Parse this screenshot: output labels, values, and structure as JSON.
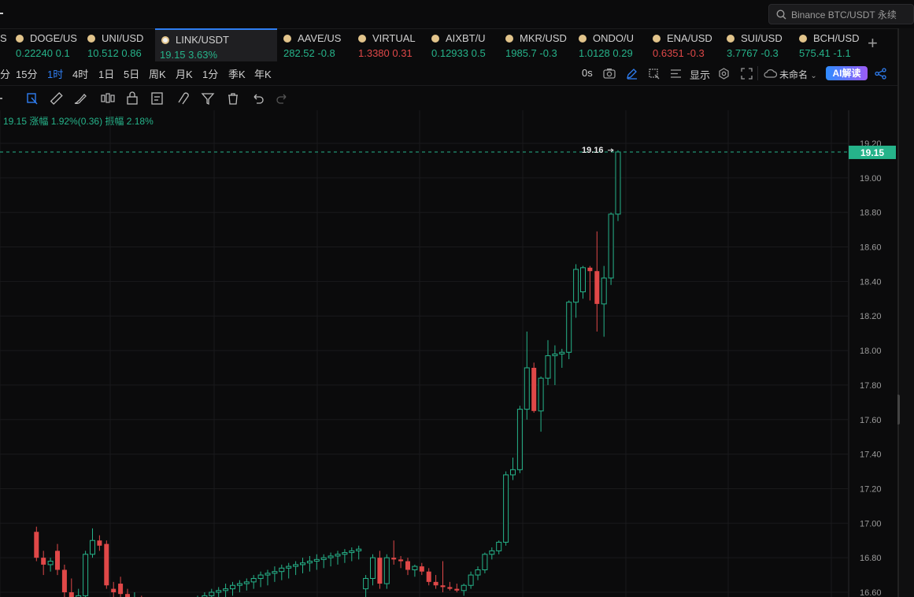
{
  "search": {
    "text": "Binance BTC/USDT 永续"
  },
  "tickers": [
    {
      "name": "S",
      "price": "",
      "change": "",
      "dir": "up",
      "icon": false
    },
    {
      "name": "DOGE/US",
      "price": "0.22240",
      "change": "0.1",
      "dir": "up",
      "icon": true
    },
    {
      "name": "UNI/USD",
      "price": "10.512",
      "change": "0.86",
      "dir": "up",
      "icon": true
    },
    {
      "name": "LINK/USDT",
      "price": "19.15",
      "change": "3.63%",
      "dir": "up",
      "icon": true,
      "active": true
    },
    {
      "name": "AAVE/US",
      "price": "282.52",
      "change": "-0.8",
      "dir": "up",
      "icon": true
    },
    {
      "name": "VIRTUAL",
      "price": "1.3380",
      "change": "0.31",
      "dir": "dn",
      "icon": true
    },
    {
      "name": "AIXBT/U",
      "price": "0.12933",
      "change": "0.5",
      "dir": "up",
      "icon": true
    },
    {
      "name": "MKR/USD",
      "price": "1985.7",
      "change": "-0.3",
      "dir": "up",
      "icon": true
    },
    {
      "name": "ONDO/U",
      "price": "1.0128",
      "change": "0.29",
      "dir": "up",
      "icon": true
    },
    {
      "name": "ENA/USD",
      "price": "0.6351",
      "change": "-0.3",
      "dir": "dn",
      "icon": true
    },
    {
      "name": "SUI/USD",
      "price": "3.7767",
      "change": "-0.3",
      "dir": "up",
      "icon": true
    },
    {
      "name": "BCH/USD",
      "price": "575.41",
      "change": "-1.1",
      "dir": "up",
      "icon": true
    }
  ],
  "intervals": [
    "分",
    "15分",
    "1时",
    "4时",
    "1日",
    "5日",
    "周K",
    "月K",
    "1分",
    "季K",
    "年K"
  ],
  "selected_interval": "1时",
  "toolbar": {
    "countdown": "0s",
    "display": "显示",
    "layout_name": "未命名",
    "ai_label": "AI解读"
  },
  "info": {
    "text": "19.15 涨幅 1.92%(0.36) 振幅 2.18%"
  },
  "colors": {
    "up": "#26b38a",
    "down": "#e04848",
    "accent": "#2f7ef2",
    "background": "#0b0b0c"
  },
  "chart_data": {
    "type": "candlestick",
    "symbol": "LINK/USDT",
    "interval": "1时",
    "ylim": [
      16.6,
      19.2
    ],
    "y_ticks": [
      "19.20",
      "19.00",
      "18.80",
      "18.60",
      "18.40",
      "18.20",
      "18.00",
      "17.80",
      "17.60",
      "17.40",
      "17.20",
      "17.00",
      "16.80",
      "16.60"
    ],
    "last_price": 19.15,
    "last_price_label": "19.15",
    "high_marker": {
      "value": 19.16,
      "label": "19.16"
    },
    "candles": [
      {
        "o": 16.95,
        "h": 16.98,
        "l": 16.78,
        "c": 16.8
      },
      {
        "o": 16.8,
        "h": 16.84,
        "l": 16.7,
        "c": 16.76
      },
      {
        "o": 16.76,
        "h": 16.8,
        "l": 16.72,
        "c": 16.78
      },
      {
        "o": 16.84,
        "h": 16.88,
        "l": 16.7,
        "c": 16.73
      },
      {
        "o": 16.73,
        "h": 16.76,
        "l": 16.55,
        "c": 16.6
      },
      {
        "o": 16.6,
        "h": 16.68,
        "l": 16.5,
        "c": 16.55
      },
      {
        "o": 16.55,
        "h": 16.62,
        "l": 16.48,
        "c": 16.58
      },
      {
        "o": 16.58,
        "h": 16.84,
        "l": 16.56,
        "c": 16.82
      },
      {
        "o": 16.82,
        "h": 16.97,
        "l": 16.8,
        "c": 16.9
      },
      {
        "o": 16.9,
        "h": 16.93,
        "l": 16.84,
        "c": 16.87
      },
      {
        "o": 16.88,
        "h": 16.9,
        "l": 16.62,
        "c": 16.64
      },
      {
        "o": 16.62,
        "h": 16.66,
        "l": 16.55,
        "c": 16.6
      },
      {
        "o": 16.65,
        "h": 16.69,
        "l": 16.56,
        "c": 16.59
      },
      {
        "o": 16.59,
        "h": 16.62,
        "l": 16.5,
        "c": 16.53
      },
      {
        "o": 16.55,
        "h": 16.6,
        "l": 16.52,
        "c": 16.56
      },
      {
        "o": 16.56,
        "h": 16.58,
        "l": 16.5,
        "c": 16.52
      },
      {
        "o": 16.53,
        "h": 16.56,
        "l": 16.49,
        "c": 16.51
      },
      {
        "o": 16.52,
        "h": 16.55,
        "l": 16.48,
        "c": 16.5
      },
      {
        "o": 16.51,
        "h": 16.53,
        "l": 16.46,
        "c": 16.49
      },
      {
        "o": 16.5,
        "h": 16.52,
        "l": 16.45,
        "c": 16.48
      },
      {
        "o": 16.49,
        "h": 16.52,
        "l": 16.44,
        "c": 16.5
      },
      {
        "o": 16.5,
        "h": 16.55,
        "l": 16.47,
        "c": 16.52
      },
      {
        "o": 16.52,
        "h": 16.56,
        "l": 16.48,
        "c": 16.54
      },
      {
        "o": 16.54,
        "h": 16.58,
        "l": 16.5,
        "c": 16.56
      },
      {
        "o": 16.56,
        "h": 16.6,
        "l": 16.52,
        "c": 16.58
      },
      {
        "o": 16.58,
        "h": 16.62,
        "l": 16.54,
        "c": 16.6
      },
      {
        "o": 16.6,
        "h": 16.63,
        "l": 16.56,
        "c": 16.61
      },
      {
        "o": 16.61,
        "h": 16.65,
        "l": 16.57,
        "c": 16.62
      },
      {
        "o": 16.62,
        "h": 16.66,
        "l": 16.58,
        "c": 16.64
      },
      {
        "o": 16.64,
        "h": 16.67,
        "l": 16.6,
        "c": 16.65
      },
      {
        "o": 16.65,
        "h": 16.68,
        "l": 16.61,
        "c": 16.66
      },
      {
        "o": 16.66,
        "h": 16.7,
        "l": 16.62,
        "c": 16.68
      },
      {
        "o": 16.68,
        "h": 16.72,
        "l": 16.63,
        "c": 16.7
      },
      {
        "o": 16.7,
        "h": 16.73,
        "l": 16.64,
        "c": 16.71
      },
      {
        "o": 16.71,
        "h": 16.75,
        "l": 16.66,
        "c": 16.72
      },
      {
        "o": 16.72,
        "h": 16.76,
        "l": 16.67,
        "c": 16.74
      },
      {
        "o": 16.74,
        "h": 16.77,
        "l": 16.68,
        "c": 16.75
      },
      {
        "o": 16.75,
        "h": 16.78,
        "l": 16.7,
        "c": 16.76
      },
      {
        "o": 16.76,
        "h": 16.8,
        "l": 16.71,
        "c": 16.77
      },
      {
        "o": 16.77,
        "h": 16.81,
        "l": 16.72,
        "c": 16.78
      },
      {
        "o": 16.78,
        "h": 16.82,
        "l": 16.73,
        "c": 16.79
      },
      {
        "o": 16.79,
        "h": 16.82,
        "l": 16.74,
        "c": 16.8
      },
      {
        "o": 16.8,
        "h": 16.83,
        "l": 16.75,
        "c": 16.81
      },
      {
        "o": 16.81,
        "h": 16.84,
        "l": 16.76,
        "c": 16.82
      },
      {
        "o": 16.82,
        "h": 16.85,
        "l": 16.77,
        "c": 16.83
      },
      {
        "o": 16.83,
        "h": 16.86,
        "l": 16.78,
        "c": 16.84
      },
      {
        "o": 16.84,
        "h": 16.87,
        "l": 16.79,
        "c": 16.85
      },
      {
        "o": 16.62,
        "h": 16.7,
        "l": 16.55,
        "c": 16.68
      },
      {
        "o": 16.68,
        "h": 16.82,
        "l": 16.64,
        "c": 16.8
      },
      {
        "o": 16.8,
        "h": 16.84,
        "l": 16.62,
        "c": 16.65
      },
      {
        "o": 16.65,
        "h": 16.82,
        "l": 16.62,
        "c": 16.8
      },
      {
        "o": 16.8,
        "h": 16.9,
        "l": 16.76,
        "c": 16.79
      },
      {
        "o": 16.79,
        "h": 16.81,
        "l": 16.74,
        "c": 16.78
      },
      {
        "o": 16.78,
        "h": 16.8,
        "l": 16.7,
        "c": 16.73
      },
      {
        "o": 16.73,
        "h": 16.76,
        "l": 16.69,
        "c": 16.75
      },
      {
        "o": 16.75,
        "h": 16.77,
        "l": 16.7,
        "c": 16.72
      },
      {
        "o": 16.72,
        "h": 16.74,
        "l": 16.64,
        "c": 16.66
      },
      {
        "o": 16.66,
        "h": 16.7,
        "l": 16.62,
        "c": 16.64
      },
      {
        "o": 16.64,
        "h": 16.78,
        "l": 16.6,
        "c": 16.63
      },
      {
        "o": 16.63,
        "h": 16.66,
        "l": 16.61,
        "c": 16.62
      },
      {
        "o": 16.62,
        "h": 16.65,
        "l": 16.6,
        "c": 16.61
      },
      {
        "o": 16.61,
        "h": 16.65,
        "l": 16.58,
        "c": 16.64
      },
      {
        "o": 16.64,
        "h": 16.72,
        "l": 16.62,
        "c": 16.7
      },
      {
        "o": 16.7,
        "h": 16.75,
        "l": 16.67,
        "c": 16.73
      },
      {
        "o": 16.73,
        "h": 16.83,
        "l": 16.71,
        "c": 16.82
      },
      {
        "o": 16.82,
        "h": 16.86,
        "l": 16.79,
        "c": 16.84
      },
      {
        "o": 16.84,
        "h": 16.9,
        "l": 16.82,
        "c": 16.89
      },
      {
        "o": 16.89,
        "h": 17.3,
        "l": 16.87,
        "c": 17.28
      },
      {
        "o": 17.28,
        "h": 17.38,
        "l": 17.25,
        "c": 17.31
      },
      {
        "o": 17.31,
        "h": 17.68,
        "l": 17.29,
        "c": 17.66
      },
      {
        "o": 17.66,
        "h": 18.11,
        "l": 17.6,
        "c": 17.9
      },
      {
        "o": 17.9,
        "h": 17.93,
        "l": 17.64,
        "c": 17.65
      },
      {
        "o": 17.65,
        "h": 17.85,
        "l": 17.53,
        "c": 17.84
      },
      {
        "o": 17.84,
        "h": 18.06,
        "l": 17.8,
        "c": 17.97
      },
      {
        "o": 17.97,
        "h": 18.03,
        "l": 17.8,
        "c": 17.98
      },
      {
        "o": 17.98,
        "h": 18.01,
        "l": 17.9,
        "c": 17.99
      },
      {
        "o": 17.99,
        "h": 18.29,
        "l": 17.95,
        "c": 18.28
      },
      {
        "o": 18.28,
        "h": 18.5,
        "l": 18.19,
        "c": 18.47
      },
      {
        "o": 18.34,
        "h": 18.49,
        "l": 18.3,
        "c": 18.48
      },
      {
        "o": 18.48,
        "h": 18.49,
        "l": 18.29,
        "c": 18.46
      },
      {
        "o": 18.46,
        "h": 18.69,
        "l": 18.11,
        "c": 18.27
      },
      {
        "o": 18.27,
        "h": 18.49,
        "l": 18.08,
        "c": 18.42
      },
      {
        "o": 18.42,
        "h": 18.8,
        "l": 18.38,
        "c": 18.79
      },
      {
        "o": 18.79,
        "h": 19.16,
        "l": 18.75,
        "c": 19.15
      }
    ]
  }
}
